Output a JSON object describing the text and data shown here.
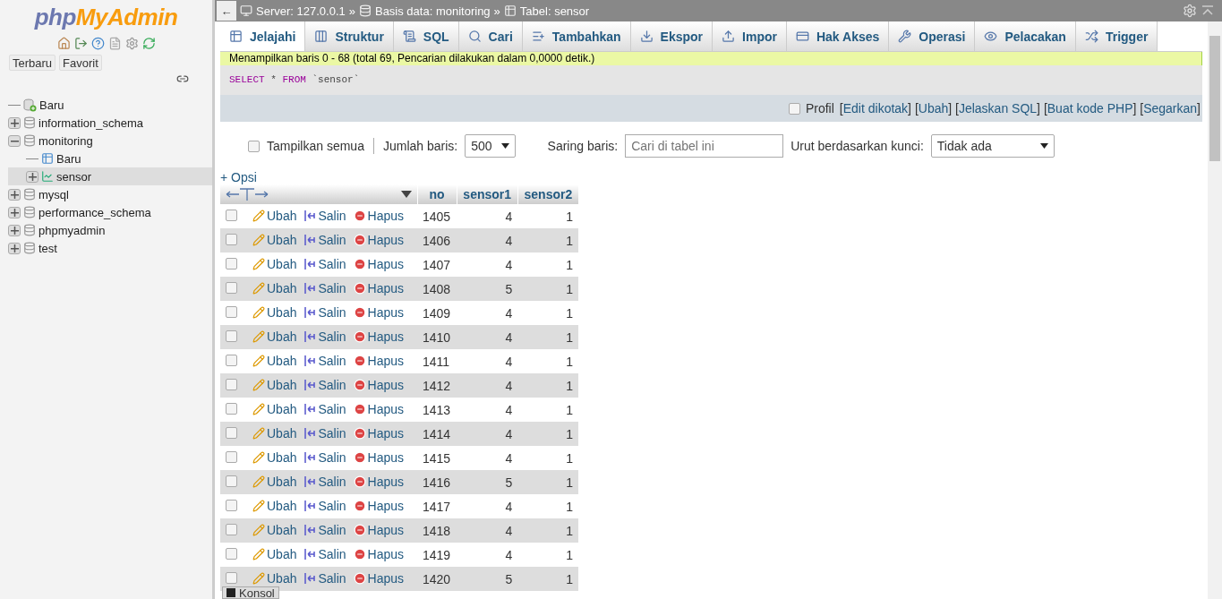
{
  "logo": {
    "part_1": "php",
    "part_2": "MyAdmin"
  },
  "sidebar": {
    "recent_button": "Terbaru",
    "favorites_button": "Favorit",
    "tree": [
      {
        "label": "Baru",
        "kind": "new",
        "selected": false
      },
      {
        "label": "information_schema",
        "kind": "db",
        "expanded": false,
        "selected": false
      },
      {
        "label": "monitoring",
        "kind": "db",
        "expanded": true,
        "selected": false,
        "children": [
          {
            "label": "Baru",
            "kind": "newtable",
            "selected": false
          },
          {
            "label": "sensor",
            "kind": "table",
            "expanded": false,
            "selected": true
          }
        ]
      },
      {
        "label": "mysql",
        "kind": "db",
        "expanded": false,
        "selected": false
      },
      {
        "label": "performance_schema",
        "kind": "db",
        "expanded": false,
        "selected": false
      },
      {
        "label": "phpmyadmin",
        "kind": "db",
        "expanded": false,
        "selected": false
      },
      {
        "label": "test",
        "kind": "db",
        "expanded": false,
        "selected": false
      }
    ]
  },
  "breadcrumb": {
    "back": "←",
    "separator": "»",
    "items": [
      {
        "label": "Server: 127.0.0.1",
        "kind": "server"
      },
      {
        "label": "Basis data: monitoring",
        "kind": "db"
      },
      {
        "label": "Tabel: sensor",
        "kind": "table"
      }
    ]
  },
  "tabs": [
    {
      "label": "Jelajahi",
      "selected": true
    },
    {
      "label": "Struktur",
      "selected": false
    },
    {
      "label": "SQL",
      "selected": false
    },
    {
      "label": "Cari",
      "selected": false
    },
    {
      "label": "Tambahkan",
      "selected": false
    },
    {
      "label": "Ekspor",
      "selected": false
    },
    {
      "label": "Impor",
      "selected": false
    },
    {
      "label": "Hak Akses",
      "selected": false
    },
    {
      "label": "Operasi",
      "selected": false
    },
    {
      "label": "Pelacakan",
      "selected": false
    },
    {
      "label": "Trigger",
      "selected": false
    }
  ],
  "message": "Menampilkan baris 0 - 68 (total 69, Pencarian dilakukan dalam 0,0000 detik.)",
  "query": {
    "keyword_1": "SELECT",
    "star": "*",
    "keyword_2": "FROM",
    "table": "`sensor`"
  },
  "query_actions": {
    "profile": {
      "label": "Profil",
      "checked": false
    },
    "links": [
      {
        "open": "[",
        "label": "Edit dikotak",
        "close": "]"
      },
      {
        "open": "[",
        "label": "Ubah",
        "close": "]"
      },
      {
        "open": "[",
        "label": "Jelaskan SQL",
        "close": "]"
      },
      {
        "open": "[",
        "label": "Buat kode PHP",
        "close": "]"
      },
      {
        "open": "[",
        "label": "Segarkan",
        "close": "]"
      }
    ]
  },
  "controls": {
    "show_all": {
      "label": "Tampilkan semua",
      "checked": false
    },
    "rows_label": "Jumlah baris:",
    "rows_value": "500",
    "filter_label": "Saring baris:",
    "filter_placeholder": "Cari di tabel ini",
    "sort_label": "Urut berdasarkan kunci:",
    "sort_value": "Tidak ada"
  },
  "options_link": "+ Opsi",
  "table": {
    "columns": [
      "no",
      "sensor1",
      "sensor2"
    ],
    "rows": [
      {
        "checked": false,
        "actions": [
          "Ubah",
          "Salin",
          "Hapus"
        ],
        "cells": [
          "1405",
          "4",
          "1"
        ]
      },
      {
        "checked": false,
        "actions": [
          "Ubah",
          "Salin",
          "Hapus"
        ],
        "cells": [
          "1406",
          "4",
          "1"
        ]
      },
      {
        "checked": false,
        "actions": [
          "Ubah",
          "Salin",
          "Hapus"
        ],
        "cells": [
          "1407",
          "4",
          "1"
        ]
      },
      {
        "checked": false,
        "actions": [
          "Ubah",
          "Salin",
          "Hapus"
        ],
        "cells": [
          "1408",
          "5",
          "1"
        ]
      },
      {
        "checked": false,
        "actions": [
          "Ubah",
          "Salin",
          "Hapus"
        ],
        "cells": [
          "1409",
          "4",
          "1"
        ]
      },
      {
        "checked": false,
        "actions": [
          "Ubah",
          "Salin",
          "Hapus"
        ],
        "cells": [
          "1410",
          "4",
          "1"
        ]
      },
      {
        "checked": false,
        "actions": [
          "Ubah",
          "Salin",
          "Hapus"
        ],
        "cells": [
          "1411",
          "4",
          "1"
        ]
      },
      {
        "checked": false,
        "actions": [
          "Ubah",
          "Salin",
          "Hapus"
        ],
        "cells": [
          "1412",
          "4",
          "1"
        ]
      },
      {
        "checked": false,
        "actions": [
          "Ubah",
          "Salin",
          "Hapus"
        ],
        "cells": [
          "1413",
          "4",
          "1"
        ]
      },
      {
        "checked": false,
        "actions": [
          "Ubah",
          "Salin",
          "Hapus"
        ],
        "cells": [
          "1414",
          "4",
          "1"
        ]
      },
      {
        "checked": false,
        "actions": [
          "Ubah",
          "Salin",
          "Hapus"
        ],
        "cells": [
          "1415",
          "4",
          "1"
        ]
      },
      {
        "checked": false,
        "actions": [
          "Ubah",
          "Salin",
          "Hapus"
        ],
        "cells": [
          "1416",
          "5",
          "1"
        ]
      },
      {
        "checked": false,
        "actions": [
          "Ubah",
          "Salin",
          "Hapus"
        ],
        "cells": [
          "1417",
          "4",
          "1"
        ]
      },
      {
        "checked": false,
        "actions": [
          "Ubah",
          "Salin",
          "Hapus"
        ],
        "cells": [
          "1418",
          "4",
          "1"
        ]
      },
      {
        "checked": false,
        "actions": [
          "Ubah",
          "Salin",
          "Hapus"
        ],
        "cells": [
          "1419",
          "4",
          "1"
        ]
      },
      {
        "checked": false,
        "actions": [
          "Ubah",
          "Salin",
          "Hapus"
        ],
        "cells": [
          "1420",
          "5",
          "1"
        ]
      }
    ]
  },
  "console": "Konsol"
}
